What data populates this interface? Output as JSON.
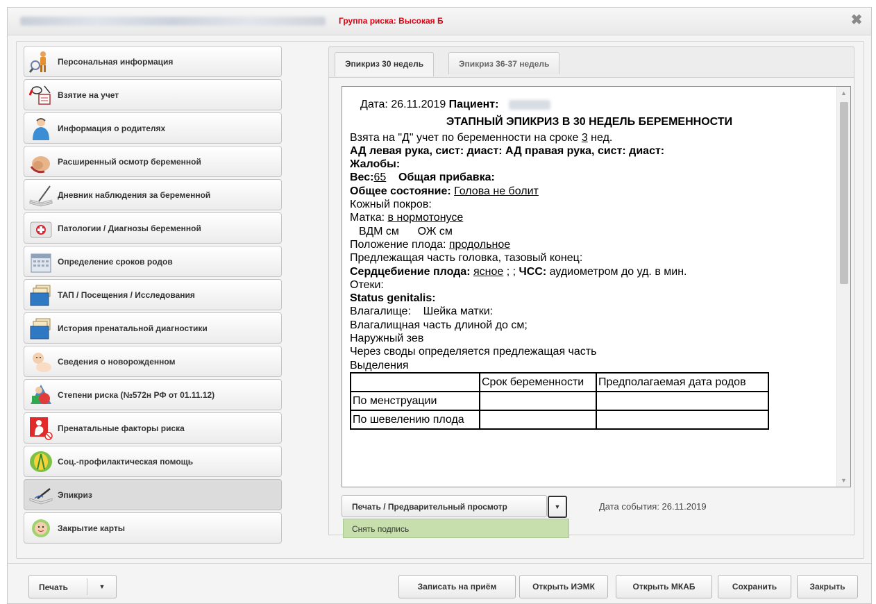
{
  "window": {
    "risk_group": "Группа риска: Высокая Б",
    "close_icon": "close-icon"
  },
  "sidebar": {
    "items": [
      {
        "label": "Персональная информация",
        "icon": "person-magnifier-icon"
      },
      {
        "label": "Взятие на учет",
        "icon": "registration-icon"
      },
      {
        "label": "Информация о родителях",
        "icon": "parents-icon"
      },
      {
        "label": "Расширенный осмотр беременной",
        "icon": "pregnant-exam-icon"
      },
      {
        "label": "Дневник наблюдения за беременной",
        "icon": "diary-icon"
      },
      {
        "label": "Патологии / Диагнозы беременной",
        "icon": "medical-kit-icon"
      },
      {
        "label": "Определение сроков родов",
        "icon": "calendar-icon"
      },
      {
        "label": "ТАП / Посещения / Исследования",
        "icon": "folders-icon"
      },
      {
        "label": "История пренатальной диагностики",
        "icon": "folders-history-icon"
      },
      {
        "label": "Сведения о новорожденном",
        "icon": "newborn-icon"
      },
      {
        "label": "Степени риска (№572н РФ от 01.11.12)",
        "icon": "risk-levels-icon"
      },
      {
        "label": "Пренатальные факторы риска",
        "icon": "prenatal-risk-icon"
      },
      {
        "label": "Соц.-профилактическая помощь",
        "icon": "social-help-icon"
      },
      {
        "label": "Эпикриз",
        "icon": "epicrisis-icon"
      },
      {
        "label": "Закрытие карты",
        "icon": "close-card-icon"
      }
    ]
  },
  "tabs": [
    {
      "label": "Эпикриз 30 недель"
    },
    {
      "label": "Эпикриз 36-37 недель"
    }
  ],
  "document": {
    "date_label": "Дата:",
    "date_value": "26.11.2019",
    "patient_label": "Пациент:",
    "title": "ЭТАПНЫЙ ЭПИКРИЗ В 30 НЕДЕЛЬ БЕРЕМЕННОСТИ",
    "registered_prefix": "Взята на \"Д\" учет по беременности на сроке ",
    "registered_weeks": "3",
    "registered_suffix": " нед.",
    "bp_line": "АД левая рука, сист:  диаст:  АД правая рука, сист:  диаст:",
    "complaints": "Жалобы:",
    "weight_label": "Вес:",
    "weight_value": "65",
    "total_gain": "Общая прибавка:",
    "general_state_label": "Общее состояние:",
    "general_state_value": "Голова не болит",
    "skin": "Кожный покров:",
    "uterus_label": "Матка: ",
    "uterus_value": "в нормотонусе",
    "vdm_ozh": "ВДМ см      ОЖ см",
    "fetus_position_label": "Положение плода: ",
    "fetus_position_value": "продольное",
    "presenting_part": "Предлежащая часть головка, тазовый конец:",
    "heartbeat_label": "Сердцебиение плода:",
    "heartbeat_value": "ясное",
    "heartbeat_sep": " ; ;",
    "hr_label": "ЧСС:",
    "hr_value": " аудиометром до уд. в мин.",
    "edema": "Отеки:",
    "status_genitalis": "Status genitalis:",
    "vagina_cervix": "Влагалище:    Шейка матки:",
    "vaginal_part": "Влагалищная часть длиной до см;",
    "external_os": "Наружный зев",
    "through_vaults": "Через своды определяется предлежащая часть",
    "discharge": "Выделения",
    "table_headers": [
      "",
      "Срок беременности",
      "Предполагаемая дата родов"
    ],
    "table_rows": [
      "По менструации",
      "По шевелению плода"
    ]
  },
  "actions": {
    "print_preview": "Печать / Предварительный просмотр",
    "event_date": "Дата события: 26.11.2019",
    "dropdown_item": "Снять подпись"
  },
  "footer": {
    "print": "Печать",
    "schedule": "Записать на приём",
    "open_iemk": "Открыть ИЭМК",
    "open_mkab": "Открыть МКАБ",
    "save": "Сохранить",
    "close": "Закрыть"
  }
}
